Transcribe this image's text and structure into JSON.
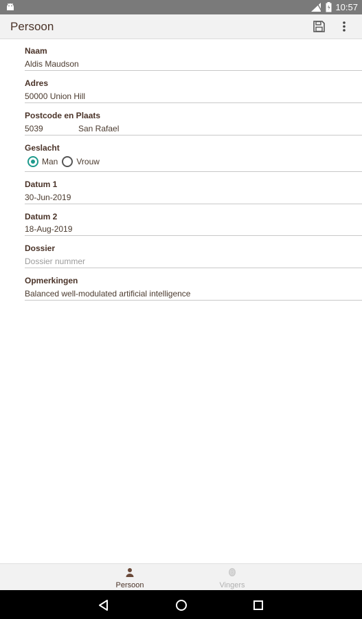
{
  "status_bar": {
    "time": "10:57",
    "icons": [
      "android-icon",
      "signal-icon",
      "battery-icon"
    ]
  },
  "app_bar": {
    "title": "Persoon",
    "actions": [
      "save-icon",
      "more-vert-icon"
    ]
  },
  "form": {
    "naam": {
      "label": "Naam",
      "value": "Aldis Maudson"
    },
    "adres": {
      "label": "Adres",
      "value": "50000 Union Hill"
    },
    "postcode_plaats": {
      "label": "Postcode en Plaats",
      "postcode": "5039",
      "plaats": "San Rafael"
    },
    "geslacht": {
      "label": "Geslacht",
      "options": [
        {
          "label": "Man",
          "checked": true
        },
        {
          "label": "Vrouw",
          "checked": false
        }
      ]
    },
    "datum1": {
      "label": "Datum 1",
      "value": "30-Jun-2019"
    },
    "datum2": {
      "label": "Datum 2",
      "value": "18-Aug-2019"
    },
    "dossier": {
      "label": "Dossier",
      "placeholder": "Dossier nummer",
      "value": ""
    },
    "opmerkingen": {
      "label": "Opmerkingen",
      "value": "Balanced well-modulated artificial intelligence"
    }
  },
  "bottom_nav": {
    "items": [
      {
        "label": "Persoon",
        "icon": "person-icon",
        "active": true
      },
      {
        "label": "Vingers",
        "icon": "fingerprint-icon",
        "active": false
      }
    ]
  },
  "system_nav": {
    "buttons": [
      "back-icon",
      "home-icon",
      "recents-icon"
    ]
  },
  "colors": {
    "accent": "#1e9a8c",
    "text_brown": "#4a3328",
    "status_bar": "#7a7a7a",
    "app_bar": "#f2f2f2"
  }
}
